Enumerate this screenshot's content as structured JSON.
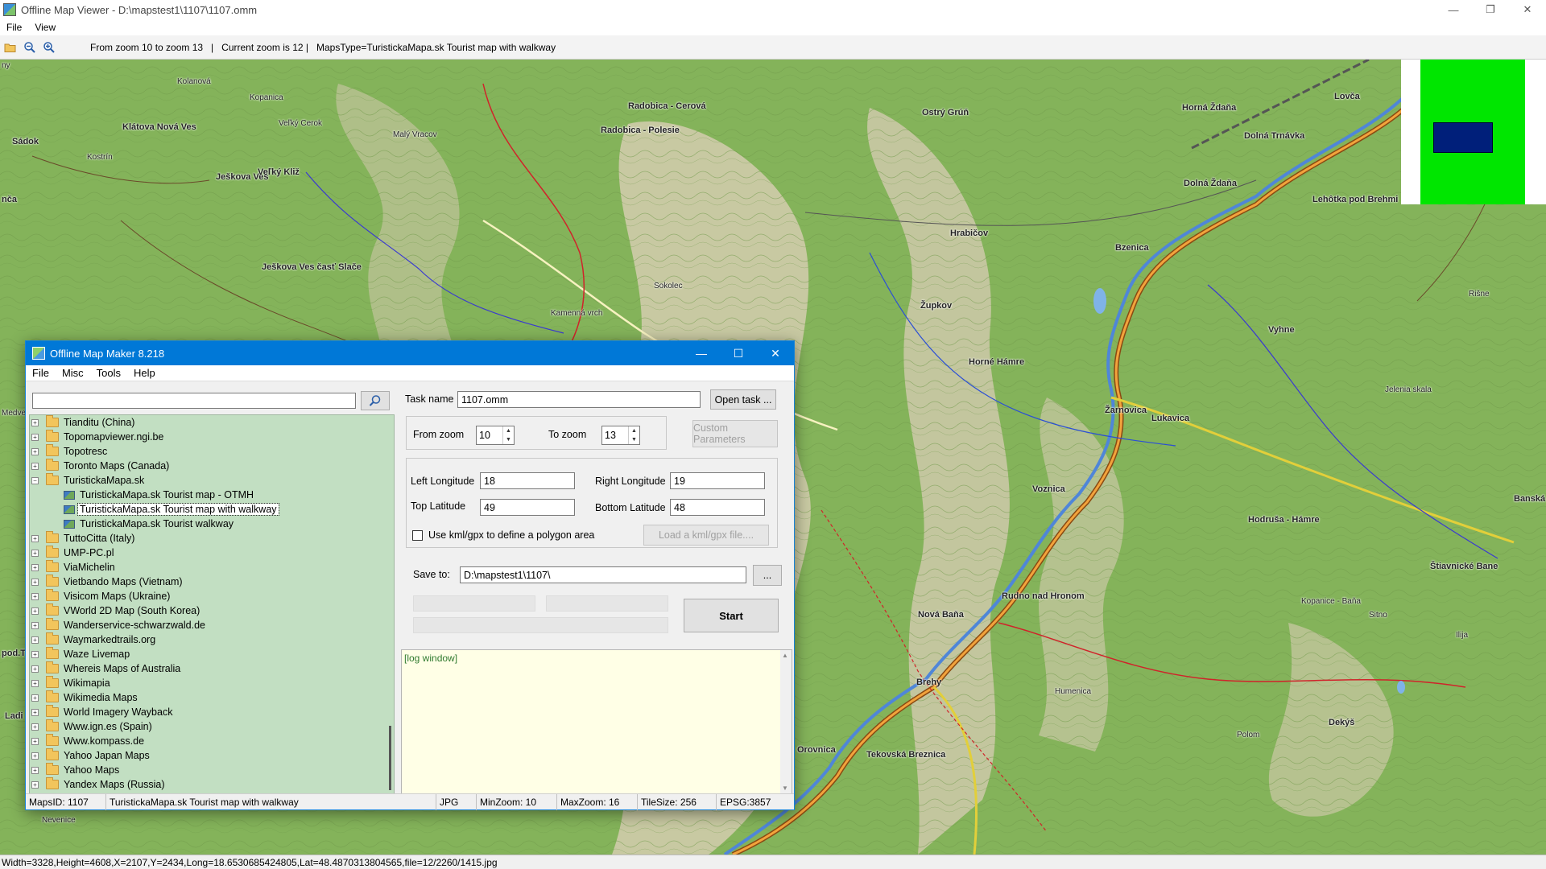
{
  "window": {
    "title": "Offline Map Viewer - D:\\mapstest1\\1107\\1107.omm",
    "controls": [
      "—",
      "❐",
      "✕"
    ]
  },
  "menubar": [
    "File",
    "View"
  ],
  "toolbar": {
    "info": "From zoom 10 to zoom 13   |   Current zoom is 12 |   MapsType=TuristickaMapa.sk Tourist map with walkway"
  },
  "map": {
    "labels": [
      {
        "text": "Klátova Nová Ves",
        "big": true
      },
      {
        "text": "Sádok",
        "big": true
      },
      {
        "text": "Ješkova Ves",
        "big": true
      },
      {
        "text": "Veľký Kliž",
        "big": true
      },
      {
        "text": "Ješkova Ves časť Slače",
        "big": true
      },
      {
        "text": "Radobica - Polesie",
        "big": true
      },
      {
        "text": "Radobica - Cerová",
        "big": true
      },
      {
        "text": "Ostrý Grúň",
        "big": true
      },
      {
        "text": "Horná Ždaňa",
        "big": true
      },
      {
        "text": "Dolná Trnávka",
        "big": true
      },
      {
        "text": "Dolná Ždaňa",
        "big": true
      },
      {
        "text": "Lovča",
        "big": true
      },
      {
        "text": "Hrabičov",
        "big": true
      },
      {
        "text": "Župkov",
        "big": true
      },
      {
        "text": "Horné Hámre",
        "big": true
      },
      {
        "text": "Bzenica",
        "big": true
      },
      {
        "text": "Žarnovica",
        "big": true
      },
      {
        "text": "Lehôtka pod Brehmi",
        "big": true
      },
      {
        "text": "Vyhne",
        "big": true
      },
      {
        "text": "Voznica",
        "big": true
      },
      {
        "text": "Lukavica",
        "big": true
      },
      {
        "text": "Hodruša - Hámre",
        "big": true
      },
      {
        "text": "Rudno nad Hronom",
        "big": true
      },
      {
        "text": "Nová Baňa",
        "big": true
      },
      {
        "text": "Brehy",
        "big": true
      },
      {
        "text": "Orovnica",
        "big": true
      },
      {
        "text": "Tekovská Breznica",
        "big": true
      },
      {
        "text": "Dekýš",
        "big": true
      },
      {
        "text": "Banská Štiavnica",
        "big": true
      },
      {
        "text": "Štiavnické Bane",
        "big": true
      },
      {
        "text": "Nevenice",
        "big": false
      },
      {
        "text": "Kostrín",
        "big": false
      },
      {
        "text": "Kolanová",
        "big": false
      },
      {
        "text": "Kopanica",
        "big": false
      },
      {
        "text": "Veľký Cerok",
        "big": false
      },
      {
        "text": "Malý Vracov",
        "big": false
      },
      {
        "text": "Sokolec",
        "big": false
      },
      {
        "text": "Kamenná vrch",
        "big": false
      },
      {
        "text": "Jelenia skala",
        "big": false
      },
      {
        "text": "Kopanice - Baňa",
        "big": false
      },
      {
        "text": "Sitno",
        "big": false
      },
      {
        "text": "Ilija",
        "big": false
      },
      {
        "text": "Rišne",
        "big": false
      },
      {
        "text": "Humenica",
        "big": false
      },
      {
        "text": "Polom",
        "big": false
      }
    ],
    "overlay_pieces": [
      {
        "text": "ny"
      },
      {
        "text": "nča"
      },
      {
        "text": "Medveď"
      },
      {
        "text": "pod.T"
      },
      {
        "text": "Ladi"
      }
    ]
  },
  "minimap": {
    "colors": {
      "background": "#00e600",
      "view": "#001f7a"
    }
  },
  "statusbar": "Width=3328,Height=4608,X=2107,Y=2434,Long=18.6530685424805,Lat=48.4870313804565,file=12/2260/1415.jpg",
  "dialog": {
    "title": "Offline Map Maker 8.218",
    "controls": [
      "—",
      "☐",
      "✕"
    ],
    "menu": [
      "File",
      "Misc",
      "Tools",
      "Help"
    ],
    "search": {
      "value": "",
      "placeholder": ""
    },
    "tree": [
      {
        "label": "Tianditu (China)",
        "type": "folder",
        "exp": "+"
      },
      {
        "label": "Topomapviewer.ngi.be",
        "type": "folder",
        "exp": "+"
      },
      {
        "label": "Topotresc",
        "type": "folder",
        "exp": "+"
      },
      {
        "label": "Toronto Maps (Canada)",
        "type": "folder",
        "exp": "+"
      },
      {
        "label": "TuristickaMapa.sk",
        "type": "folder",
        "exp": "−"
      },
      {
        "label": "TuristickaMapa.sk Tourist map - OTMH",
        "type": "child",
        "selected": false
      },
      {
        "label": "TuristickaMapa.sk Tourist map with walkway",
        "type": "child",
        "selected": true
      },
      {
        "label": "TuristickaMapa.sk Tourist walkway",
        "type": "child",
        "selected": false
      },
      {
        "label": "TuttoCitta (Italy)",
        "type": "folder",
        "exp": "+"
      },
      {
        "label": "UMP-PC.pl",
        "type": "folder",
        "exp": "+"
      },
      {
        "label": "ViaMichelin",
        "type": "folder",
        "exp": "+"
      },
      {
        "label": "Vietbando Maps (Vietnam)",
        "type": "folder",
        "exp": "+"
      },
      {
        "label": "Visicom Maps (Ukraine)",
        "type": "folder",
        "exp": "+"
      },
      {
        "label": "VWorld 2D Map (South Korea)",
        "type": "folder",
        "exp": "+"
      },
      {
        "label": "Wanderservice-schwarzwald.de",
        "type": "folder",
        "exp": "+"
      },
      {
        "label": "Waymarkedtrails.org",
        "type": "folder",
        "exp": "+"
      },
      {
        "label": "Waze Livemap",
        "type": "folder",
        "exp": "+"
      },
      {
        "label": "Whereis Maps of Australia",
        "type": "folder",
        "exp": "+"
      },
      {
        "label": "Wikimapia",
        "type": "folder",
        "exp": "+"
      },
      {
        "label": "Wikimedia Maps",
        "type": "folder",
        "exp": "+"
      },
      {
        "label": "World Imagery Wayback",
        "type": "folder",
        "exp": "+"
      },
      {
        "label": "Www.ign.es (Spain)",
        "type": "folder",
        "exp": "+"
      },
      {
        "label": "Www.kompass.de",
        "type": "folder",
        "exp": "+"
      },
      {
        "label": "Yahoo Japan Maps",
        "type": "folder",
        "exp": "+"
      },
      {
        "label": "Yahoo Maps",
        "type": "folder",
        "exp": "+"
      },
      {
        "label": "Yandex Maps (Russia)",
        "type": "folder",
        "exp": "+"
      }
    ],
    "form": {
      "task_name_label": "Task name",
      "task_name_value": "1107.omm",
      "open_task_label": "Open task ...",
      "from_zoom_label": "From zoom",
      "from_zoom_value": "10",
      "to_zoom_label": "To zoom",
      "to_zoom_value": "13",
      "custom_params_label": "Custom Parameters",
      "left_lon_label": "Left Longitude",
      "left_lon_value": "18",
      "right_lon_label": "Right Longitude",
      "right_lon_value": "19",
      "top_lat_label": "Top Latitude",
      "top_lat_value": "49",
      "bottom_lat_label": "Bottom Latitude",
      "bottom_lat_value": "48",
      "kml_checkbox_label": "Use kml/gpx to define a polygon area",
      "load_kml_label": "Load a kml/gpx file....",
      "save_to_label": "Save to:",
      "save_to_value": "D:\\mapstest1\\1107\\",
      "browse_label": "...",
      "start_label": "Start"
    },
    "log_text": "[log window]",
    "status": {
      "maps_id": "MapsID: 1107",
      "map_name": "TuristickaMapa.sk Tourist map with walkway",
      "format": "JPG",
      "min_zoom": "MinZoom: 10",
      "max_zoom": "MaxZoom: 16",
      "tile_size": "TileSize: 256",
      "epsg": "EPSG:3857"
    }
  }
}
